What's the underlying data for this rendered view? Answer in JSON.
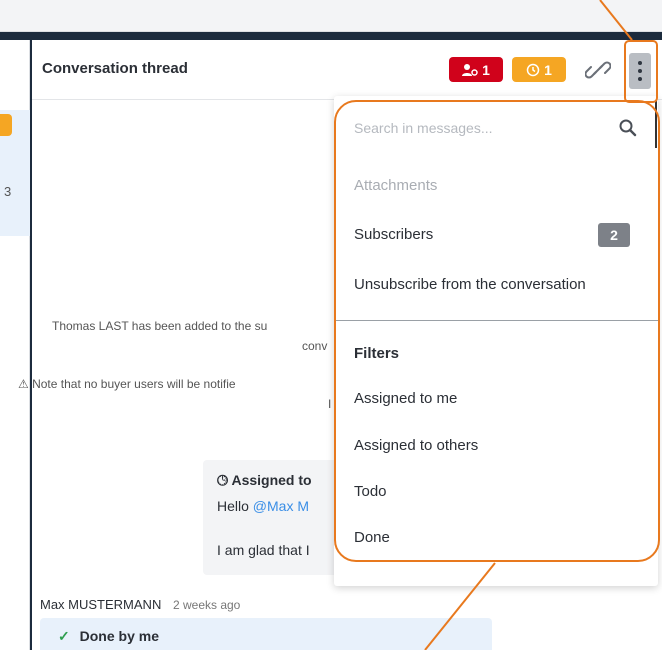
{
  "header": {
    "title": "Conversation thread",
    "assignee_badge_count": "1",
    "pending_badge_count": "1",
    "colors": {
      "assignee_badge": "#d0021b",
      "pending_badge": "#f5a623",
      "highlight": "#e8791e"
    }
  },
  "left_column": {
    "partial_text": "3"
  },
  "system_messages": {
    "line1": "Thomas LAST has been added to the su",
    "line2": "conv",
    "line3": "⚠ Note that no buyer users will be notifie",
    "line4": "I"
  },
  "bubble": {
    "title": "Assigned to",
    "line1_prefix": "Hello ",
    "line1_mention": "@Max M",
    "line2": "I am glad that I"
  },
  "footer_message": {
    "author": "Max MUSTERMANN",
    "time": "2 weeks ago",
    "done_label": "Done by me"
  },
  "menu": {
    "search_placeholder": "Search in messages...",
    "attachments": "Attachments",
    "subscribers": "Subscribers",
    "subscribers_count": "2",
    "unsubscribe": "Unsubscribe from the conversation",
    "filters_heading": "Filters",
    "assigned_to_me": "Assigned to me",
    "assigned_to_others": "Assigned to others",
    "todo": "Todo",
    "done": "Done"
  }
}
